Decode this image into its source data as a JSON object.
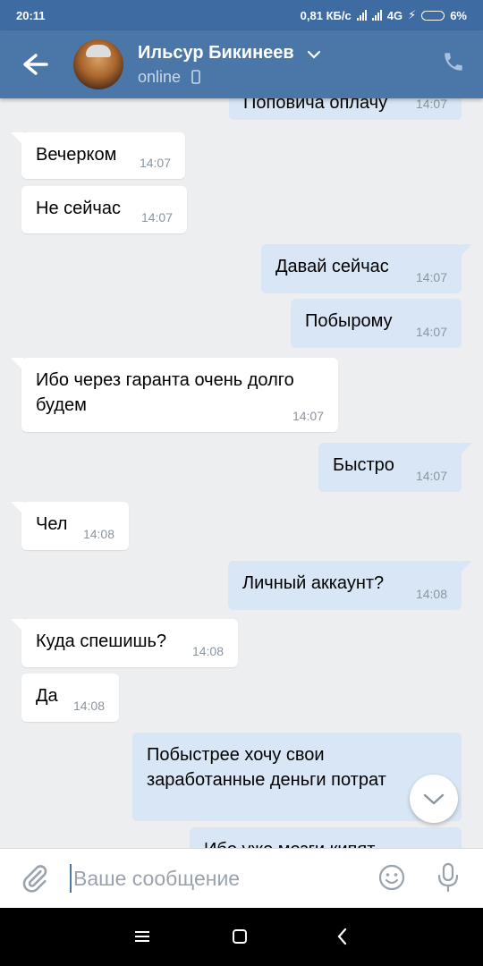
{
  "status_bar": {
    "time": "20:11",
    "net_speed": "0,81 КБ/с",
    "network": "4G",
    "battery": "6%"
  },
  "header": {
    "contact_name": "Ильсур Бикинеев",
    "contact_status": "online",
    "accent_color": "#4a76a8",
    "icons": [
      "back-arrow-icon",
      "chevron-down-icon",
      "mobile-icon",
      "phone-icon"
    ]
  },
  "messages": [
    {
      "dir": "out",
      "text": "Поповича оплачу",
      "time": "14:07"
    },
    {
      "dir": "in",
      "text": "Вечерком",
      "time": "14:07"
    },
    {
      "dir": "in",
      "text": "Не сейчас",
      "time": "14:07"
    },
    {
      "dir": "out",
      "text": "Давай сейчас",
      "time": "14:07"
    },
    {
      "dir": "out",
      "text": "Побырому",
      "time": "14:07"
    },
    {
      "dir": "in",
      "text": "Ибо через гаранта очень долго будем",
      "time": "14:07"
    },
    {
      "dir": "out",
      "text": "Быстро",
      "time": "14:07"
    },
    {
      "dir": "in",
      "text": "Чел",
      "time": "14:08"
    },
    {
      "dir": "out",
      "text": "Личный аккаунт?",
      "time": "14:08"
    },
    {
      "dir": "in",
      "text": "Куда спешишь?",
      "time": "14:08"
    },
    {
      "dir": "in",
      "text": "Да",
      "time": "14:08"
    },
    {
      "dir": "out",
      "text": "Побыстрее хочу свои заработанные деньги потрат",
      "time": ""
    },
    {
      "dir": "out",
      "text": "Ибо уже мозги кипят",
      "time": ""
    }
  ],
  "composer": {
    "placeholder": "Ваше сообщение",
    "icons": [
      "attach-icon",
      "emoji-icon",
      "microphone-icon"
    ]
  },
  "nav": {
    "icons": [
      "menu-icon",
      "home-icon",
      "back-icon"
    ]
  }
}
